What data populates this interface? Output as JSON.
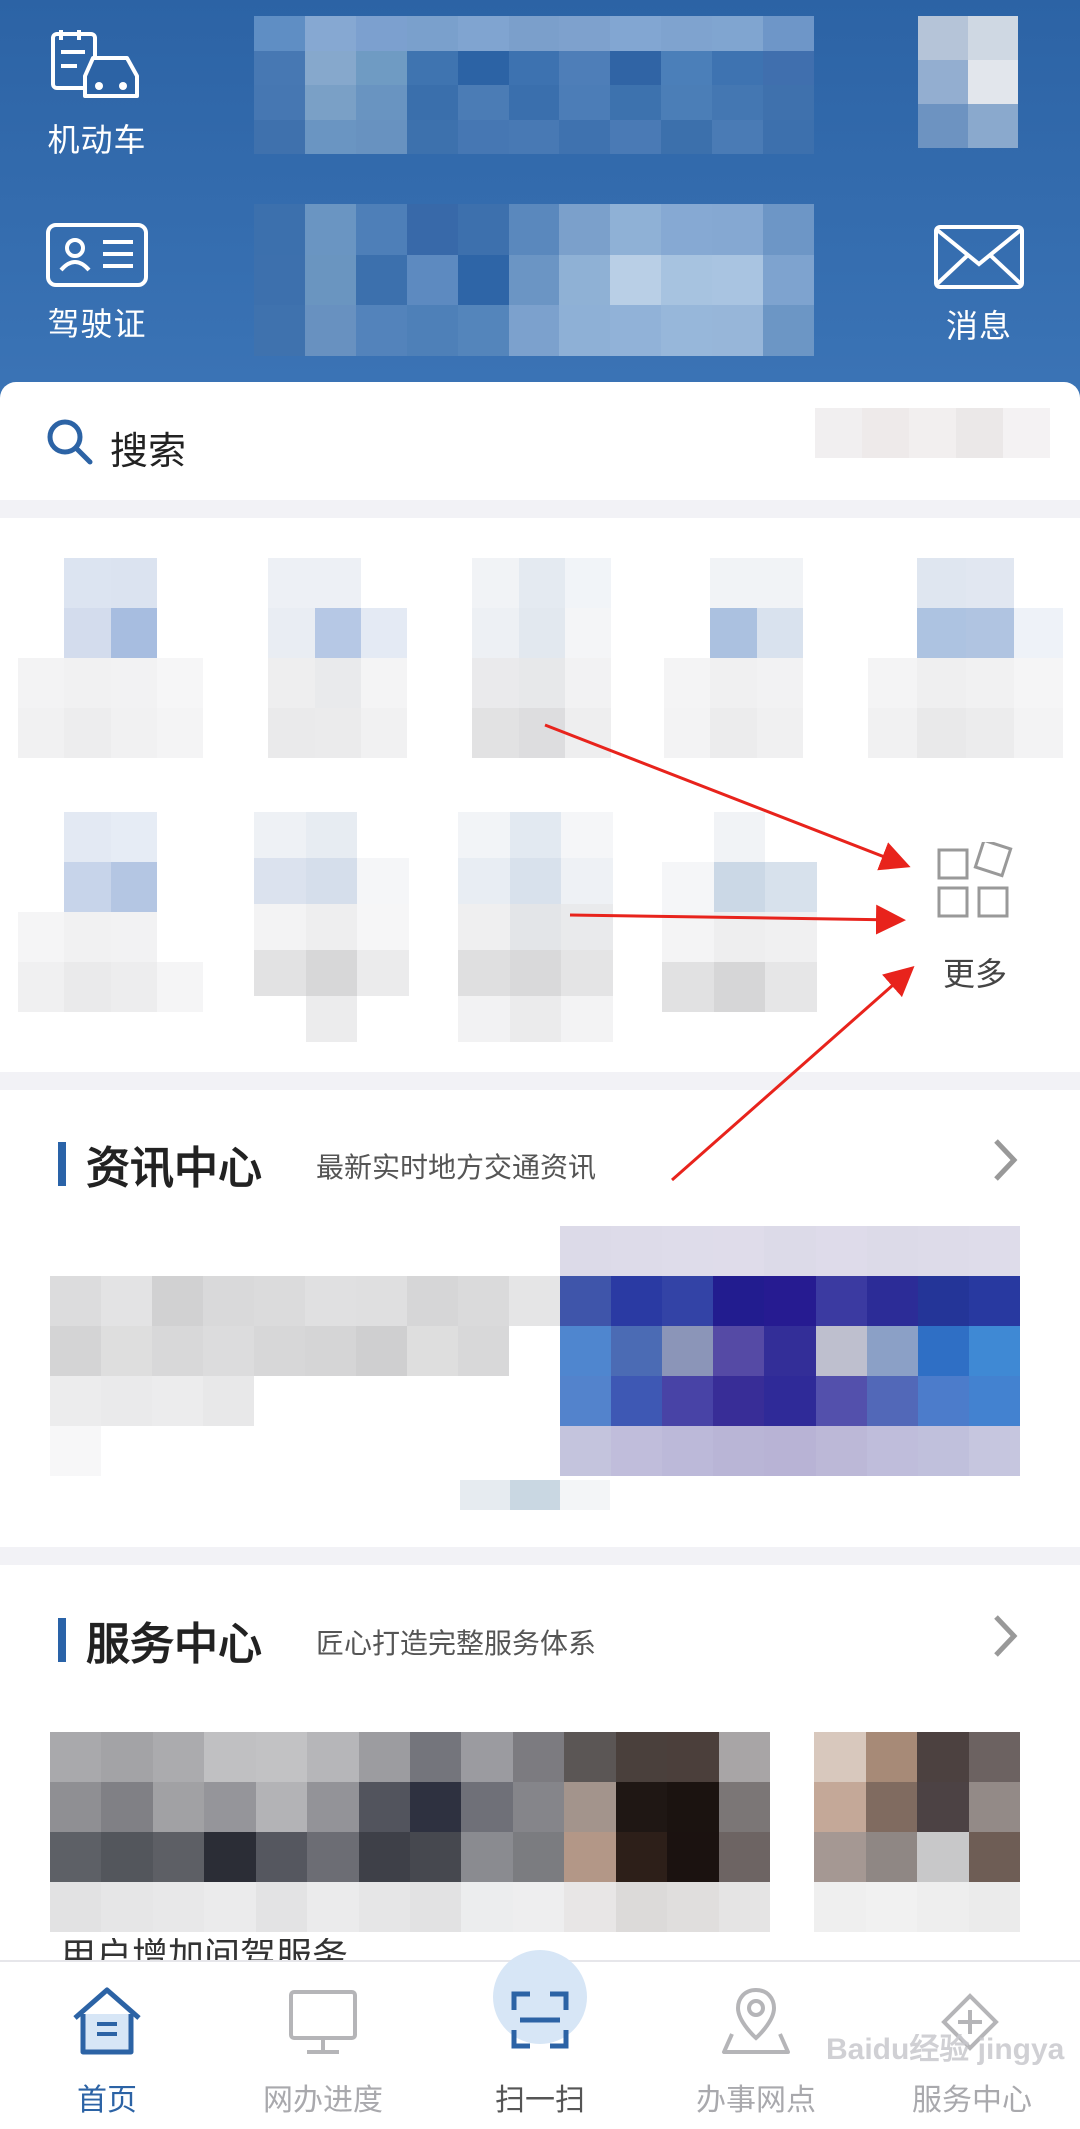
{
  "header": {
    "vehicle_label": "机动车",
    "license_label": "驾驶证",
    "message_label": "消息",
    "vehicle_icon": "car-doc-icon",
    "license_icon": "id-card-icon",
    "message_icon": "envelope-icon"
  },
  "search": {
    "placeholder": "搜索",
    "icon": "search-icon"
  },
  "quick_services": {
    "more_label": "更多",
    "more_icon": "grid-more-icon"
  },
  "news": {
    "title": "资讯中心",
    "subtitle": "最新实时地方交通资讯"
  },
  "service": {
    "title": "服务中心",
    "subtitle": "匠心打造完整服务体系",
    "partial_text": "用户增加间驾服务"
  },
  "bottom_nav": {
    "items": [
      {
        "label": "首页",
        "icon": "home-icon",
        "active": true
      },
      {
        "label": "网办进度",
        "icon": "monitor-icon",
        "active": false
      },
      {
        "label": "扫一扫",
        "icon": "scan-icon",
        "active": false
      },
      {
        "label": "办事网点",
        "icon": "map-pin-icon",
        "active": false
      },
      {
        "label": "服务中心",
        "icon": "service-icon",
        "active": false
      }
    ]
  },
  "watermark": "Baidu经验 jingyan.baidu.com",
  "colors": {
    "brand_blue": "#2c63a5",
    "annotation_red": "#e8231c"
  }
}
